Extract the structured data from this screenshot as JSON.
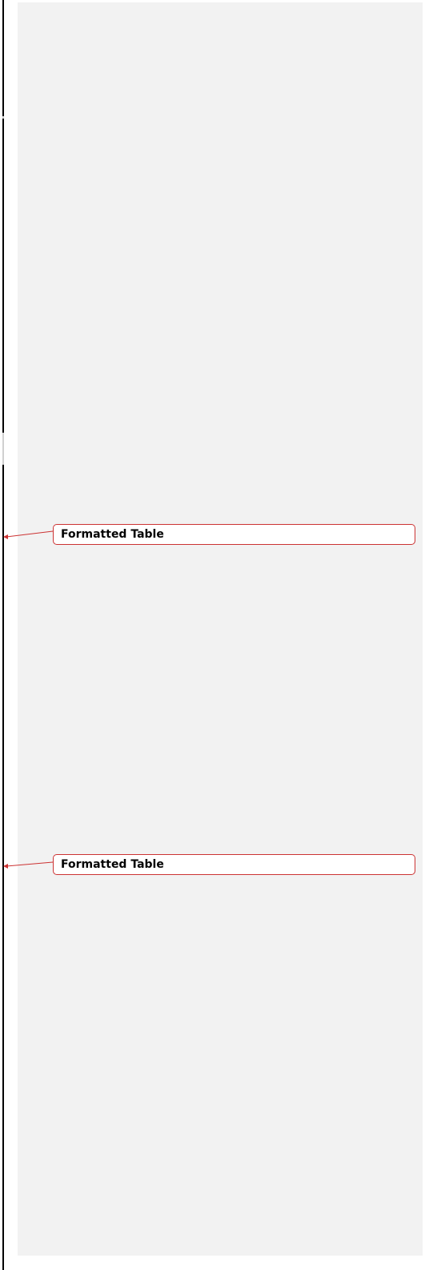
{
  "comments": [
    {
      "label": "Formatted Table"
    },
    {
      "label": "Formatted Table"
    }
  ],
  "colors": {
    "balloon_border": "#cc3333",
    "markup_pane": "#f2f2f2"
  }
}
